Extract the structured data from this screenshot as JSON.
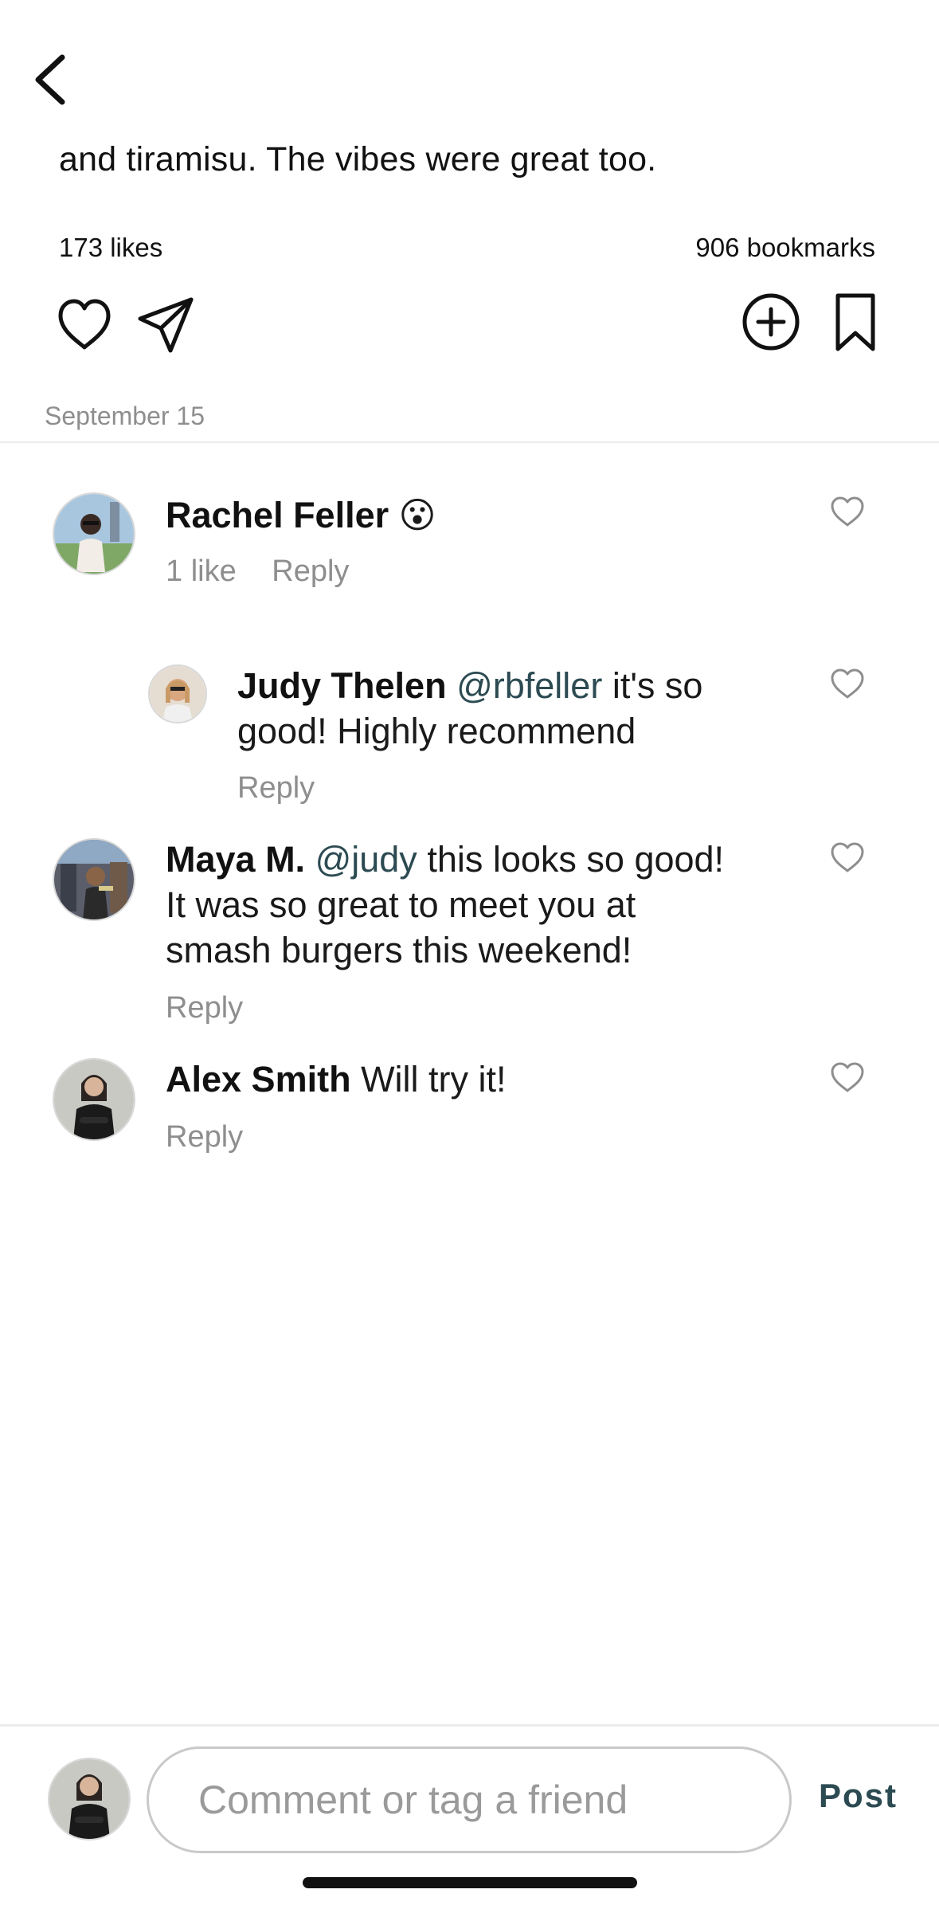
{
  "post": {
    "caption": "and tiramisu. The vibes were great too.",
    "likes_text": "173 likes",
    "bookmarks_text": "906 bookmarks",
    "date": "September 15"
  },
  "icons": {
    "back": "chevron-left-icon",
    "like": "heart-icon",
    "share": "paper-plane-icon",
    "add": "plus-circle-icon",
    "bookmark": "bookmark-icon"
  },
  "comments": [
    {
      "author": "Rachel Feller",
      "mention": "",
      "text": "",
      "emoji": "😮",
      "likes_text": "1 like",
      "reply_label": "Reply"
    },
    {
      "author": "Judy Thelen",
      "mention": "@rbfeller",
      "text": "it's so",
      "text_line2": "good! Highly recommend",
      "reply_label": "Reply"
    },
    {
      "author": "Maya M.",
      "mention": "@judy",
      "text": "this looks so good!",
      "text_line2": "It was so great to meet you at",
      "text_line3": "smash burgers this weekend!",
      "reply_label": "Reply"
    },
    {
      "author": "Alex Smith",
      "mention": "",
      "text": "Will try it!",
      "reply_label": "Reply"
    }
  ],
  "composer": {
    "placeholder": "Comment or tag a friend",
    "value": "",
    "post_label": "Post"
  },
  "colors": {
    "accent": "#2c4a52",
    "secondary_text": "#8e8e8e",
    "divider": "#ececec"
  }
}
